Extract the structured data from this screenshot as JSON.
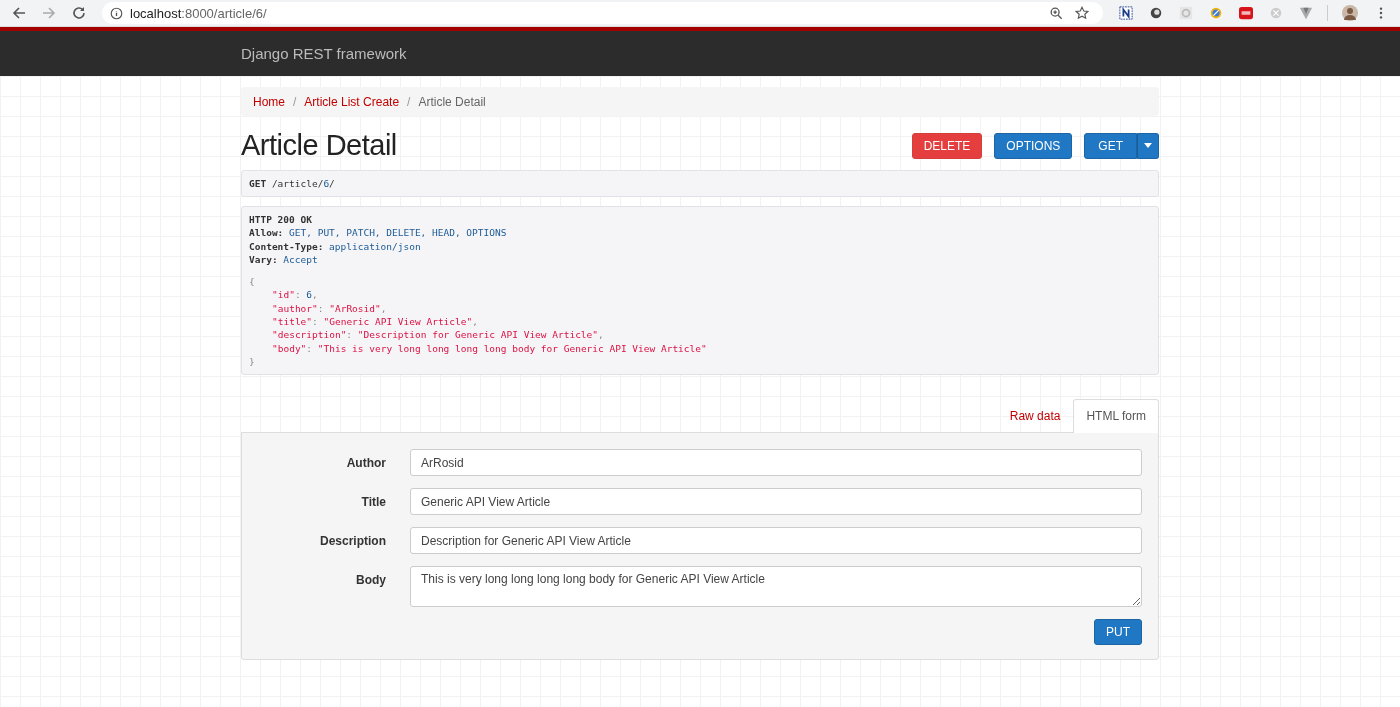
{
  "browser": {
    "url_host": "localhost",
    "url_rest": ":8000/article/6/"
  },
  "navbar": {
    "brand": "Django REST framework"
  },
  "breadcrumbs": [
    {
      "label": "Home",
      "current": false
    },
    {
      "label": "Article List Create",
      "current": false,
      "separator": "/"
    },
    {
      "label": "Article Detail",
      "current": true,
      "separator": "/"
    }
  ],
  "page": {
    "title": "Article Detail"
  },
  "actions": [
    {
      "label": "DELETE",
      "kind": "danger"
    },
    {
      "label": "OPTIONS",
      "kind": "primary"
    },
    {
      "label": "GET",
      "kind": "split"
    }
  ],
  "request": {
    "method": "GET",
    "path": "/article/",
    "path_id": "6",
    "path_end": "/"
  },
  "response": {
    "status": "HTTP 200 OK",
    "headers": [
      {
        "name": "Allow:",
        "value": "GET, PUT, PATCH, DELETE, HEAD, OPTIONS"
      },
      {
        "name": "Content-Type:",
        "value": "application/json"
      },
      {
        "name": "Vary:",
        "value": "Accept"
      }
    ],
    "open": "{",
    "fields": [
      {
        "key": "\"id\"",
        "colon": ": ",
        "value": "6",
        "comma": ",",
        "kind": "number"
      },
      {
        "key": "\"author\"",
        "colon": ": ",
        "value": "\"ArRosid\"",
        "comma": ",",
        "kind": "string"
      },
      {
        "key": "\"title\"",
        "colon": ": ",
        "value": "\"Generic API View Article\"",
        "comma": ",",
        "kind": "string"
      },
      {
        "key": "\"description\"",
        "colon": ": ",
        "value": "\"Description for Generic API View Article\"",
        "comma": ",",
        "kind": "string"
      },
      {
        "key": "\"body\"",
        "colon": ": ",
        "value": "\"This is very long long long long body for Generic API View Article\"",
        "kind": "string"
      }
    ],
    "close": "}"
  },
  "tabs": [
    {
      "label": "Raw data",
      "selected": false
    },
    {
      "label": "HTML form",
      "selected": true
    }
  ],
  "form": {
    "fields": [
      {
        "label": "Author",
        "value": "ArRosid",
        "kind": "input"
      },
      {
        "label": "Title",
        "value": "Generic API View Article",
        "kind": "input"
      },
      {
        "label": "Description",
        "value": "Description for Generic API View Article",
        "kind": "input"
      },
      {
        "label": "Body",
        "value": "This is very long long long long body for Generic API View Article",
        "kind": "textarea"
      }
    ],
    "submit": "PUT"
  }
}
